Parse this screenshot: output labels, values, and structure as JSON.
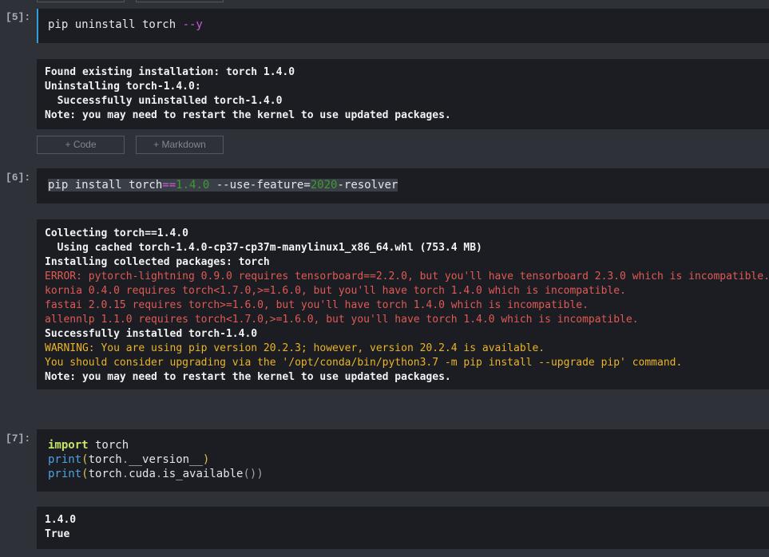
{
  "cells": [
    {
      "prompt": "[5]:",
      "code": {
        "cmd": "pip uninstall torch ",
        "flag": "--y"
      },
      "output": [
        "Found existing installation: torch 1.4.0",
        "Uninstalling torch-1.4.0:",
        "  Successfully uninstalled torch-1.4.0",
        "Note: you may need to restart the kernel to use updated packages."
      ]
    },
    {
      "prompt": "[6]:",
      "code": {
        "part1": "pip install torch",
        "eq": "==",
        "version": "1.4.0",
        "part2": " --use-feature=",
        "year": "2020",
        "part3": "-resolver"
      },
      "output": {
        "normal_start": [
          "Collecting torch==1.4.0",
          "  Using cached torch-1.4.0-cp37-cp37m-manylinux1_x86_64.whl (753.4 MB)",
          "Installing collected packages: torch"
        ],
        "errors": [
          "ERROR: pytorch-lightning 0.9.0 requires tensorboard==2.2.0, but you'll have tensorboard 2.3.0 which is incompatible.",
          "kornia 0.4.0 requires torch<1.7.0,>=1.6.0, but you'll have torch 1.4.0 which is incompatible.",
          "fastai 2.0.15 requires torch>=1.6.0, but you'll have torch 1.4.0 which is incompatible.",
          "allennlp 1.1.0 requires torch<1.7.0,>=1.6.0, but you'll have torch 1.4.0 which is incompatible."
        ],
        "success": "Successfully installed torch-1.4.0",
        "warnings": [
          "WARNING: You are using pip version 20.2.3; however, version 20.2.4 is available.",
          "You should consider upgrading via the '/opt/conda/bin/python3.7 -m pip install --upgrade pip' command."
        ],
        "note": "Note: you may need to restart the kernel to use updated packages."
      }
    },
    {
      "prompt": "[7]:",
      "code": {
        "line1_kw": "import",
        "line1_rest": " torch",
        "line2_fn": "print",
        "line2_open": "(",
        "line2_obj": "torch",
        "line2_dot": ".",
        "line2_attr": "__version__",
        "line2_close": ")",
        "line3_fn": "print",
        "line3_open": "(",
        "line3_obj": "torch",
        "line3_dot1": ".",
        "line3_attr1": "cuda",
        "line3_dot2": ".",
        "line3_attr2": "is_available",
        "line3_call": "()",
        "line3_close": ")"
      },
      "output": [
        "1.4.0",
        "True"
      ]
    }
  ],
  "buttons": {
    "add_code": "+ Code",
    "add_markdown": "+ Markdown"
  }
}
